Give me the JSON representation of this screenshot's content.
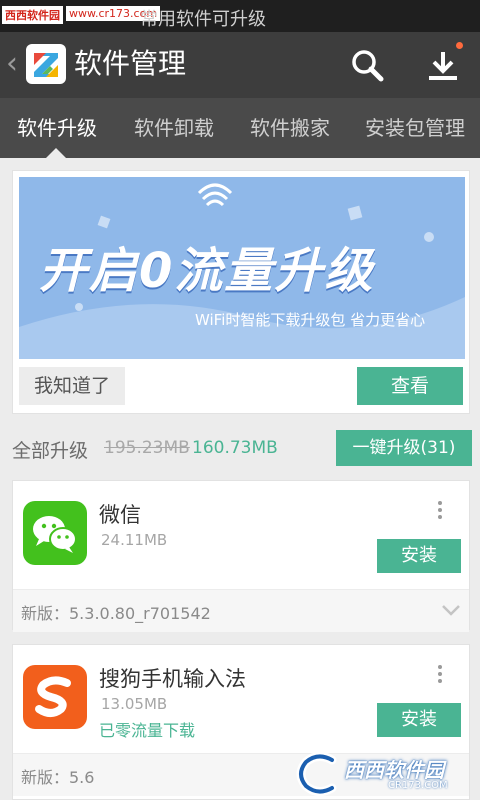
{
  "statusbar": {
    "watermark_site": "西西软件园",
    "watermark_url": "www.cr173.com",
    "notification_text": "常用软件可升级"
  },
  "appbar": {
    "title": "软件管理",
    "icons": [
      "back-icon",
      "app-logo",
      "search-icon",
      "download-icon"
    ]
  },
  "tabs": [
    {
      "label": "软件升级",
      "active": true
    },
    {
      "label": "软件卸载",
      "active": false
    },
    {
      "label": "软件搬家",
      "active": false
    },
    {
      "label": "安装包管理",
      "active": false
    }
  ],
  "promo": {
    "banner_title": "开启0流量升级",
    "banner_subtitle": "WiFi时智能下载升级包  省力更省心",
    "dismiss_label": "我知道了",
    "view_label": "查看"
  },
  "summary": {
    "label": "全部升级",
    "old_size": "195.23MB",
    "new_size": "160.73MB",
    "upgrade_all_label": "一键升级(31)"
  },
  "apps": [
    {
      "name": "微信",
      "size": "24.11MB",
      "note": "",
      "install_label": "安装",
      "version": "新版：5.3.0.80_r701542",
      "icon": "wechat-icon"
    },
    {
      "name": "搜狗手机输入法",
      "size": "13.05MB",
      "note": "已零流量下载",
      "install_label": "安装",
      "version": "新版：5.6",
      "icon": "sogou-icon"
    }
  ],
  "watermark": {
    "label": "西西软件园",
    "url": "CR173.COM"
  },
  "colors": {
    "accent": "#4ab493",
    "appbar": "#3d3d3d",
    "tabbar": "#4a4a4a",
    "banner": "#8fb8e9",
    "background": "#ececec"
  }
}
